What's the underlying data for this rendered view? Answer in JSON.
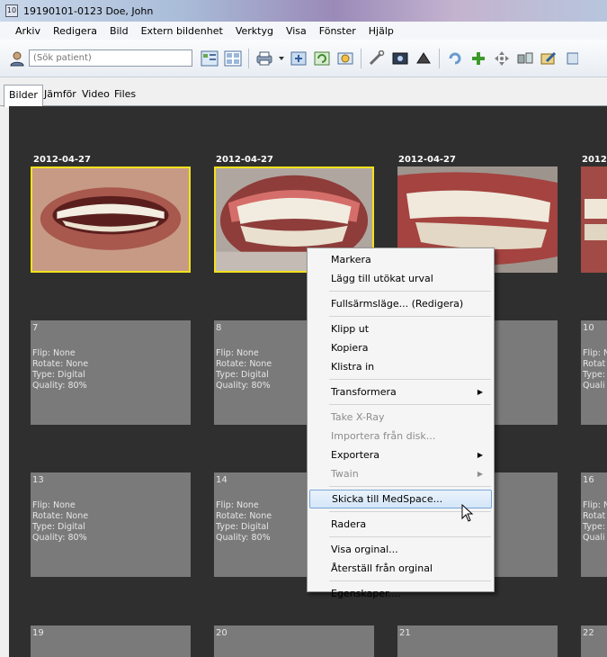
{
  "window": {
    "title": "19190101-0123 Doe, John",
    "icon_label": "10"
  },
  "menu": [
    "Arkiv",
    "Redigera",
    "Bild",
    "Extern bildenhet",
    "Verktyg",
    "Visa",
    "Fönster",
    "Hjälp"
  ],
  "search": {
    "placeholder": "(Sök patient)"
  },
  "tabs": [
    "Bilder",
    "Jämför",
    "Video",
    "Files"
  ],
  "photos": [
    {
      "date": "2012-04-27",
      "selected": true
    },
    {
      "date": "2012-04-27",
      "selected": true
    },
    {
      "date": "2012-04-27",
      "selected": false
    },
    {
      "date": "2012-"
    }
  ],
  "cards_row2": [
    {
      "num": "7",
      "info": "Flip: None\nRotate: None\nType: Digital\nQuality: 80%"
    },
    {
      "num": "8",
      "info": "Flip: None\nRotate: None\nType: Digital\nQuality: 80%"
    },
    {
      "num": "10",
      "info": "Flip: N\nRotat\nType:\nQuali"
    }
  ],
  "cards_row3": [
    {
      "num": "13",
      "info": "Flip: None\nRotate: None\nType: Digital\nQuality: 80%"
    },
    {
      "num": "14",
      "info": "Flip: None\nRotate: None\nType: Digital\nQuality: 80%"
    },
    {
      "num": "16",
      "info": "Flip: N\nRotat\nType:\nQuali"
    }
  ],
  "cards_row4": [
    {
      "num": "19"
    },
    {
      "num": "20"
    },
    {
      "num": "21"
    },
    {
      "num": "22"
    }
  ],
  "context_menu": {
    "items": [
      {
        "label": "Markera"
      },
      {
        "label": "Lägg till utökat urval"
      },
      {
        "label": "Fullsärmsläge... (Redigera)"
      },
      {
        "label": "Klipp ut"
      },
      {
        "label": "Kopiera"
      },
      {
        "label": "Klistra in"
      },
      {
        "label": "Transformera",
        "submenu_arrow": "▶"
      },
      {
        "label": "Take X-Ray",
        "disabled": true
      },
      {
        "label": "Importera från disk...",
        "disabled": true
      },
      {
        "label": "Exportera",
        "submenu_arrow": "▶"
      },
      {
        "label": "Twain",
        "disabled": true,
        "submenu_arrow": "▶"
      },
      {
        "label": "Skicka till MedSpace...",
        "highlighted": true
      },
      {
        "label": "Radera"
      },
      {
        "label": "Visa orginal..."
      },
      {
        "label": "Återställ från orginal"
      },
      {
        "label": "Egenskaper...."
      }
    ]
  },
  "colors": {
    "selection_border": "#f2e21b",
    "background_dark": "#2f2f2f",
    "card": "#7a7a7a",
    "menu_highlight": "#d4e6f8"
  }
}
